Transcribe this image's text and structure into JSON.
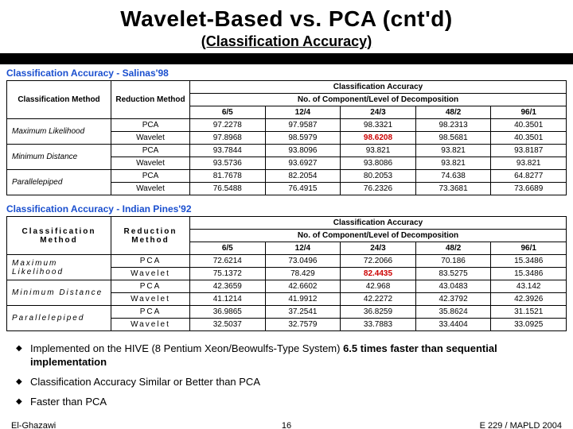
{
  "title": "Wavelet-Based vs. PCA (cnt'd)",
  "subtitle": "(Classification Accuracy)",
  "table1": {
    "caption": "Classification Accuracy - Salinas'98",
    "h_class": "Classification Method",
    "h_red": "Reduction Method",
    "h_group": "Classification Accuracy",
    "h_sub": "No. of Component/Level of Decomposition",
    "cols": [
      "6/5",
      "12/4",
      "24/3",
      "48/2",
      "96/1"
    ],
    "rows": [
      {
        "cls": "Maximum Likelihood",
        "red": "PCA",
        "v": [
          "97.2278",
          "97.9587",
          "98.3321",
          "98.2313",
          "40.3501"
        ]
      },
      {
        "cls": "",
        "red": "Wavelet",
        "v": [
          "97.8968",
          "98.5979",
          "98.6208",
          "98.5681",
          "40.3501"
        ],
        "hi": 2
      },
      {
        "cls": "Minimum Distance",
        "red": "PCA",
        "v": [
          "93.7844",
          "93.8096",
          "93.821",
          "93.821",
          "93.8187"
        ]
      },
      {
        "cls": "",
        "red": "Wavelet",
        "v": [
          "93.5736",
          "93.6927",
          "93.8086",
          "93.821",
          "93.821"
        ]
      },
      {
        "cls": "Parallelepiped",
        "red": "PCA",
        "v": [
          "81.7678",
          "82.2054",
          "80.2053",
          "74.638",
          "64.8277"
        ]
      },
      {
        "cls": "",
        "red": "Wavelet",
        "v": [
          "76.5488",
          "76.4915",
          "76.2326",
          "73.3681",
          "73.6689"
        ]
      }
    ]
  },
  "table2": {
    "caption": "Classification Accuracy - Indian Pines'92",
    "h_class": "Classification Method",
    "h_red": "Reduction Method",
    "h_group": "Classification Accuracy",
    "h_sub": "No. of Component/Level of Decomposition",
    "cols": [
      "6/5",
      "12/4",
      "24/3",
      "48/2",
      "96/1"
    ],
    "rows": [
      {
        "cls": "Maximum Likelihood",
        "red": "PCA",
        "v": [
          "72.6214",
          "73.0496",
          "72.2066",
          "70.186",
          "15.3486"
        ]
      },
      {
        "cls": "",
        "red": "Wavelet",
        "v": [
          "75.1372",
          "78.429",
          "82.4435",
          "83.5275",
          "15.3486"
        ],
        "hi": 2
      },
      {
        "cls": "Minimum Distance",
        "red": "PCA",
        "v": [
          "42.3659",
          "42.6602",
          "42.968",
          "43.0483",
          "43.142"
        ]
      },
      {
        "cls": "",
        "red": "Wavelet",
        "v": [
          "41.1214",
          "41.9912",
          "42.2272",
          "42.3792",
          "42.3926"
        ]
      },
      {
        "cls": "Parallelepiped",
        "red": "PCA",
        "v": [
          "36.9865",
          "37.2541",
          "36.8259",
          "35.8624",
          "31.1521"
        ]
      },
      {
        "cls": "",
        "red": "Wavelet",
        "v": [
          "32.5037",
          "32.7579",
          "33.7883",
          "33.4404",
          "33.0925"
        ]
      }
    ]
  },
  "bullets": [
    {
      "pre": "Implemented on the HIVE (8 Pentium Xeon/Beowulfs-Type System) ",
      "bold": "6.5 times faster than sequential implementation"
    },
    {
      "pre": "Classification Accuracy Similar or Better than PCA",
      "bold": ""
    },
    {
      "pre": "Faster than PCA",
      "bold": ""
    }
  ],
  "footer": {
    "left": "El-Ghazawi",
    "center": "16",
    "right": "E 229 / MAPLD 2004"
  }
}
